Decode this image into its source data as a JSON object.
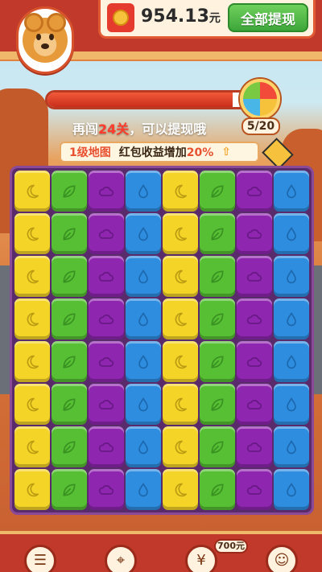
{
  "header": {
    "balance": "954.13",
    "balance_unit": "元",
    "withdraw_all_label": "全部提现"
  },
  "progress": {
    "fraction": 0.9,
    "hint_prefix": "再闯",
    "hint_levels": "24关",
    "hint_suffix": "，可以提现哦",
    "wheel_count": "5/20"
  },
  "map_info": {
    "level": "1级地图",
    "bonus_prefix": "红包收益增加",
    "bonus_pct": "20%"
  },
  "board": {
    "columns": [
      "yellow-moon",
      "green-leaf",
      "purple-cloud",
      "blue-drop",
      "yellow-moon",
      "green-leaf",
      "purple-cloud",
      "blue-drop"
    ],
    "rows": 8
  },
  "bottom_nav": {
    "badge": "700元",
    "items": [
      "tasks-icon",
      "map-icon",
      "yuan-icon",
      "profile-icon"
    ]
  },
  "colors": {
    "yellow": "#f5d428",
    "green": "#57bf34",
    "purple": "#8f26b0",
    "blue": "#2f8de0",
    "header_red": "#c0392b",
    "withdraw_green": "#3da63a"
  }
}
